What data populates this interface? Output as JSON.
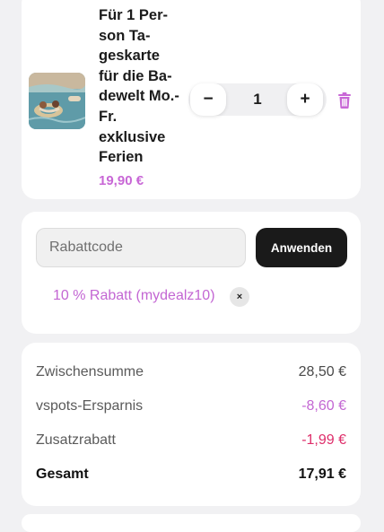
{
  "product": {
    "title": "Für 1 Per­son Ta­geskarte für die Ba­dewelt Mo.-Fr. exklusive Ferien",
    "price": "19,90 €",
    "quantity": "1",
    "minus_label": "−",
    "plus_label": "+",
    "thumbnail_icon": "pool-photo",
    "trash_icon": "trash-icon",
    "trash_color": "#c867d6"
  },
  "coupon": {
    "placeholder": "Rabattcode",
    "value": "",
    "apply_label": "Anwenden",
    "applied_text": "10 % Rabatt (mydealz10)",
    "remove_label": "×"
  },
  "summary": {
    "rows": [
      {
        "label": "Zwischensumme",
        "value": "28,50 €"
      },
      {
        "label": "vspots-Ersparnis",
        "value": "-8,60 €"
      },
      {
        "label": "Zusatzrabatt",
        "value": "-1,99 €"
      },
      {
        "label": "Gesamt",
        "value": "17,91 €"
      }
    ]
  },
  "colors": {
    "accent": "#c867d6",
    "discount": "#de2e6a",
    "button_dark": "#1a1a1a",
    "background": "#f1f1f3"
  }
}
